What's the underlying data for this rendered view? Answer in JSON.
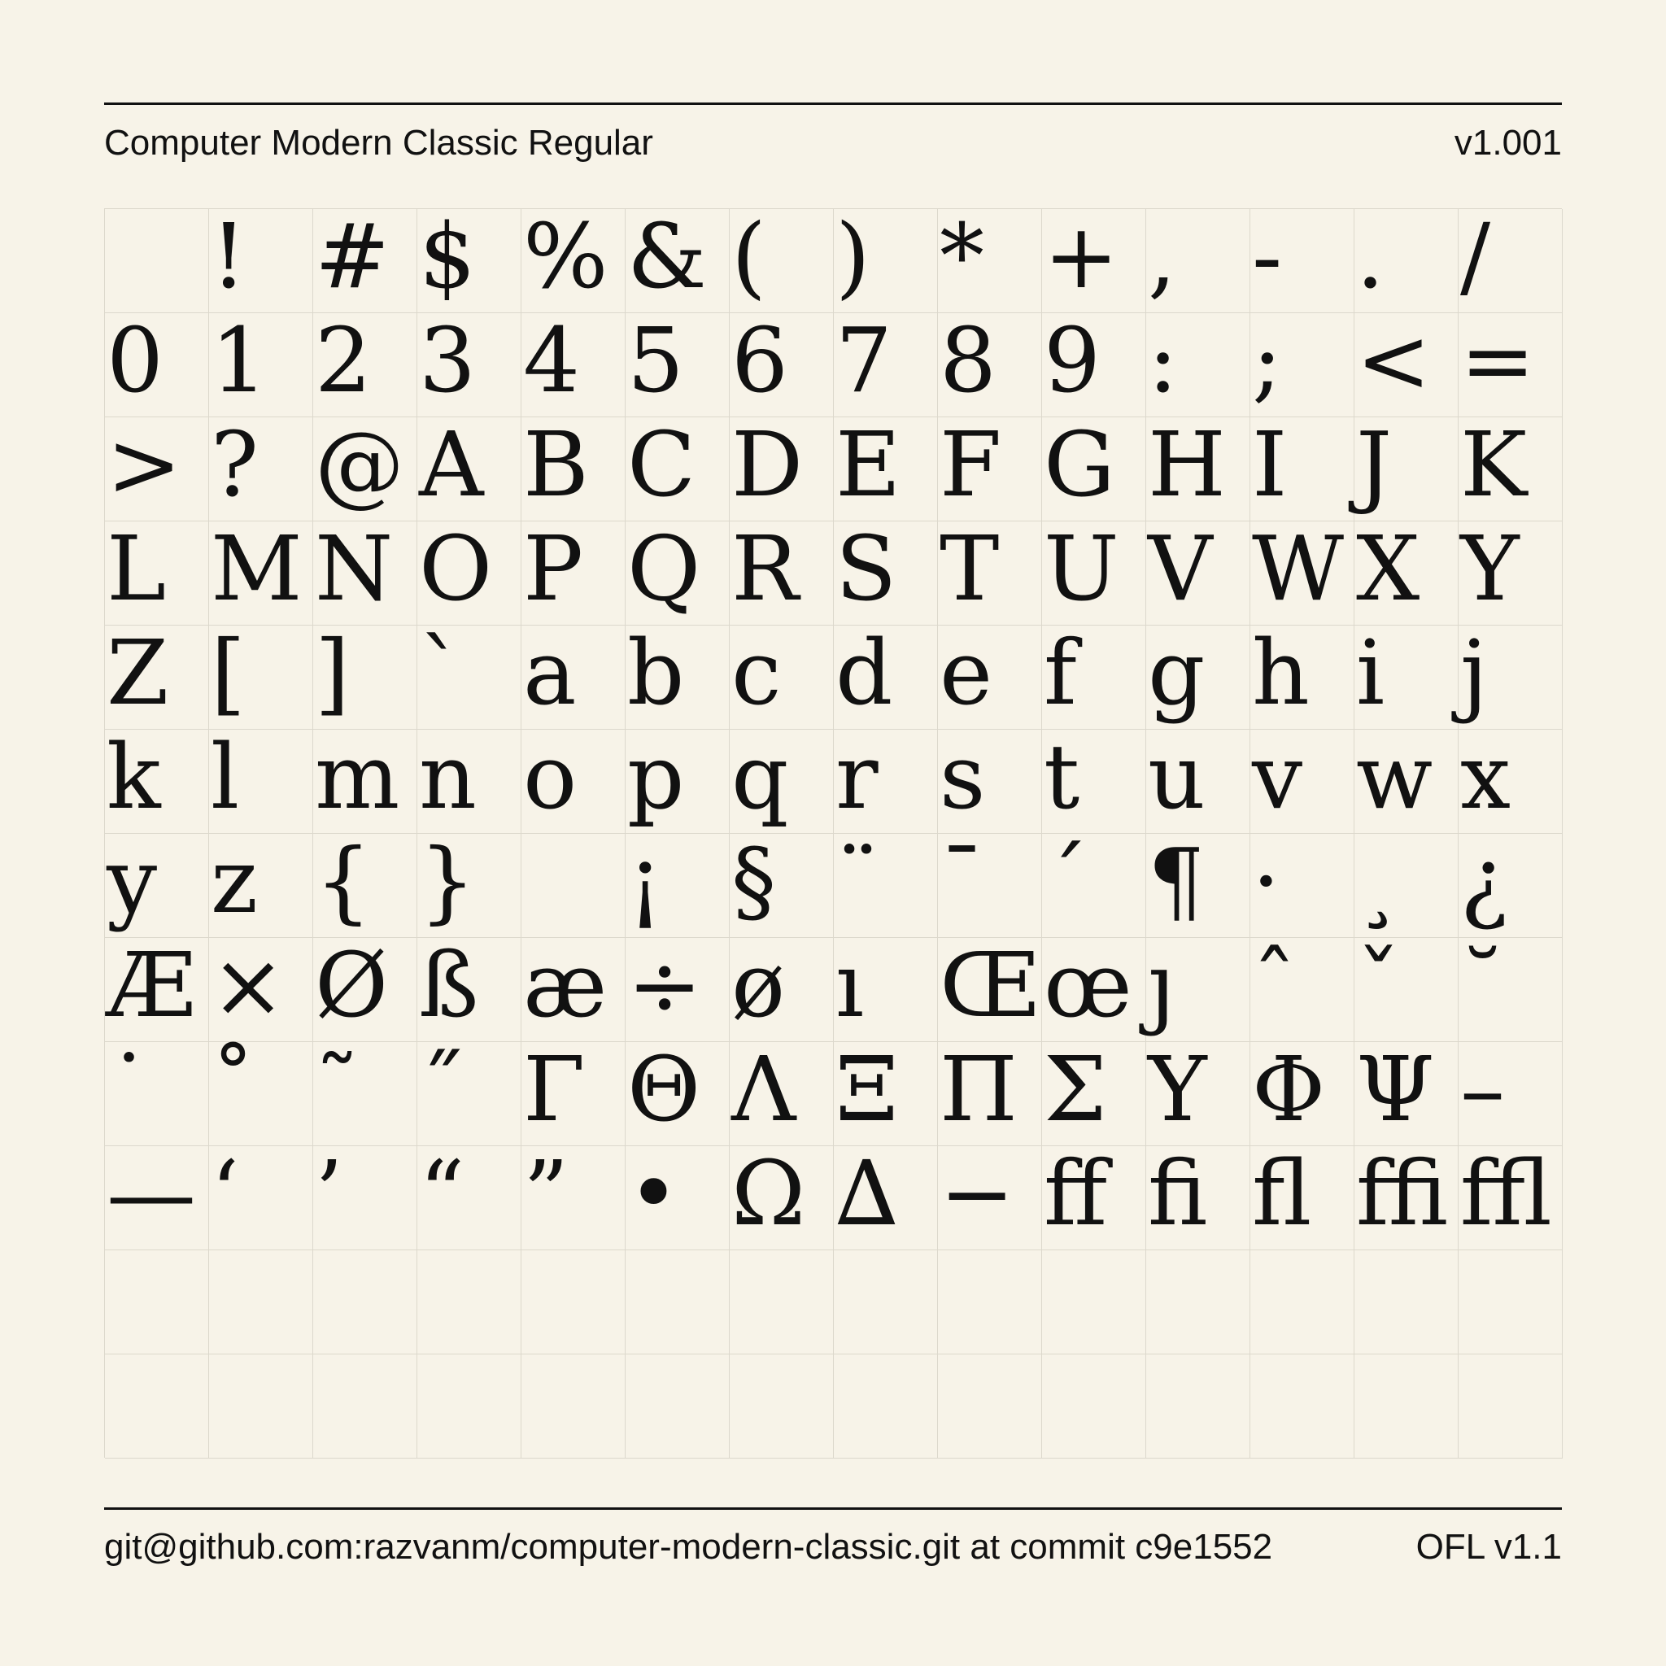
{
  "header": {
    "font_name": "Computer Modern Classic Regular",
    "version": "v1.001"
  },
  "footer": {
    "source": "git@github.com:razvanm/computer-modern-classic.git at commit c9e1552",
    "license": "OFL v1.1"
  },
  "glyphs": [
    " ",
    "!",
    "#",
    "$",
    "%",
    "&",
    "(",
    ")",
    "*",
    "+",
    ",",
    "-",
    ".",
    "/",
    "0",
    "1",
    "2",
    "3",
    "4",
    "5",
    "6",
    "7",
    "8",
    "9",
    ":",
    ";",
    "<",
    "=",
    ">",
    "?",
    "@",
    "A",
    "B",
    "C",
    "D",
    "E",
    "F",
    "G",
    "H",
    "I",
    "J",
    "K",
    "L",
    "M",
    "N",
    "O",
    "P",
    "Q",
    "R",
    "S",
    "T",
    "U",
    "V",
    "W",
    "X",
    "Y",
    "Z",
    "[",
    "]",
    "`",
    "a",
    "b",
    "c",
    "d",
    "e",
    "f",
    "g",
    "h",
    "i",
    "j",
    "k",
    "l",
    "m",
    "n",
    "o",
    "p",
    "q",
    "r",
    "s",
    "t",
    "u",
    "v",
    "w",
    "x",
    "y",
    "z",
    "{",
    "}",
    " ",
    "¡",
    "§",
    "¨",
    "¯",
    "´",
    "¶",
    "·",
    "¸",
    "¿",
    "Æ",
    "×",
    "Ø",
    "ß",
    "æ",
    "÷",
    "ø",
    "ı",
    "Œ",
    "œ",
    "ȷ",
    "ˆ",
    "ˇ",
    "˘",
    "˙",
    "˚",
    "˜",
    "˝",
    "Γ",
    "Θ",
    "Λ",
    "Ξ",
    "Π",
    "Σ",
    "Υ",
    "Φ",
    "Ψ",
    "–",
    "—",
    "‘",
    "’",
    "“",
    "”",
    "•",
    "Ω",
    "∆",
    "−",
    "ﬀ",
    "ﬁ",
    "ﬂ",
    "ﬃ",
    "ﬄ",
    "",
    "",
    "",
    "",
    "",
    "",
    "",
    "",
    "",
    "",
    "",
    "",
    "",
    "",
    "",
    "",
    "",
    "",
    "",
    "",
    "",
    "",
    "",
    "",
    "",
    "",
    "",
    ""
  ]
}
